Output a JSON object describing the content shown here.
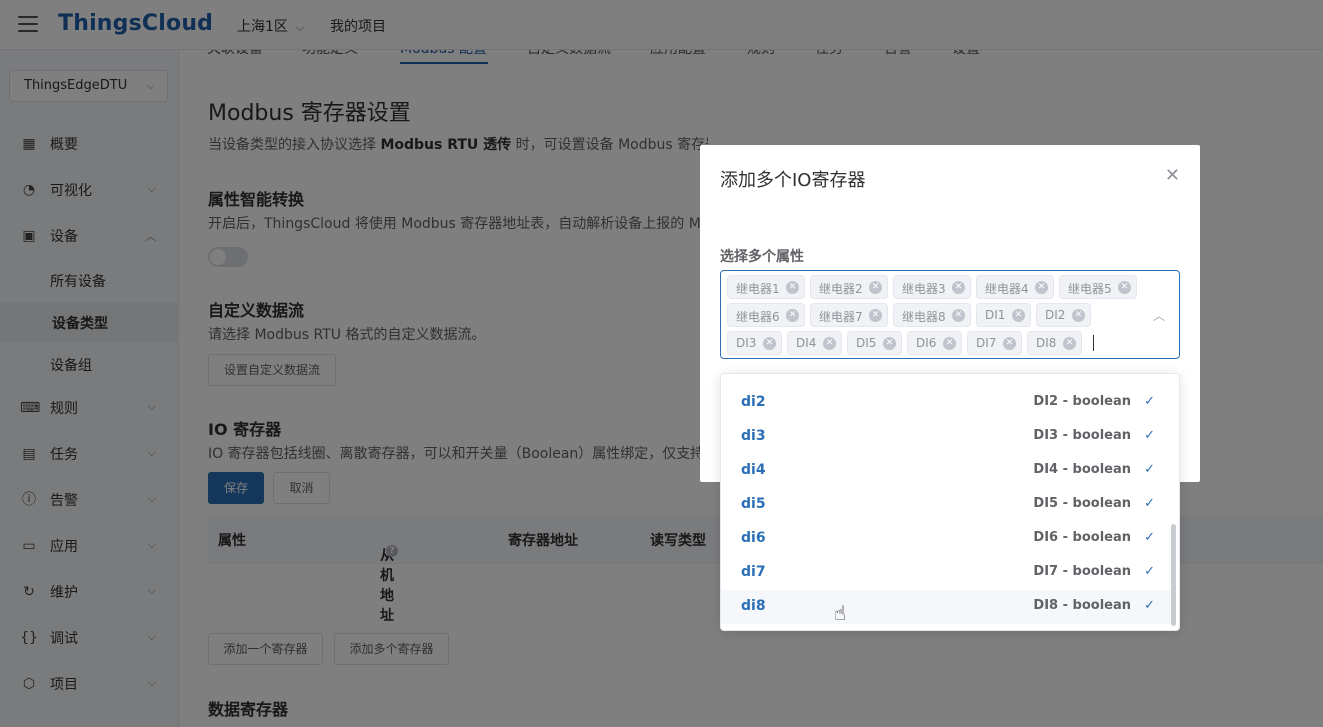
{
  "header": {
    "logo": "ThingsCloud",
    "region": "上海1区",
    "project": "我的项目"
  },
  "sidebar": {
    "device_select": "ThingsEdgeDTU",
    "items": [
      {
        "label": "概要",
        "icon": "dashboard-icon"
      },
      {
        "label": "可视化",
        "icon": "gauge-icon"
      },
      {
        "label": "设备",
        "icon": "device-icon"
      },
      {
        "label": "规则",
        "icon": "terminal-icon"
      },
      {
        "label": "任务",
        "icon": "calendar-icon"
      },
      {
        "label": "告警",
        "icon": "alert-icon"
      },
      {
        "label": "应用",
        "icon": "app-window-icon"
      },
      {
        "label": "维护",
        "icon": "refresh-icon"
      },
      {
        "label": "调试",
        "icon": "braces-icon"
      },
      {
        "label": "项目",
        "icon": "cube-icon"
      }
    ],
    "sub_items": [
      {
        "label": "所有设备"
      },
      {
        "label": "设备类型"
      },
      {
        "label": "设备组"
      }
    ]
  },
  "main": {
    "tabs": [
      "关联设备",
      "功能定义",
      "Modbus 配置",
      "自定义数据流",
      "应用配置",
      "规则",
      "任务",
      "告警",
      "设置"
    ],
    "title": "Modbus 寄存器设置",
    "desc_prefix": "当设备类型的接入协议选择 ",
    "desc_bold": "Modbus RTU 透传",
    "desc_suffix": " 时，可设置设备 Modbus 寄存器地址，用于设备属性和 Modbus 消息之间的自动转换。",
    "smart": {
      "title": "属性智能转换",
      "desc": "开启后，ThingsCloud 将使用 Modbus 寄存器地址表，自动解析设备上报的 M"
    },
    "custom_stream": {
      "title": "自定义数据流",
      "desc": "请选择 Modbus RTU 格式的自定义数据流。",
      "button": "设置自定义数据流"
    },
    "io": {
      "title": "IO 寄存器",
      "desc": "IO 寄存器包括线圈、离散寄存器，可以和开关量（Boolean）属性绑定，仅支持",
      "save": "保存",
      "cancel": "取消",
      "columns": [
        "属性",
        "从机地址",
        "寄存器地址",
        "读写类型"
      ],
      "add_one": "添加一个寄存器",
      "add_many": "添加多个寄存器"
    },
    "data_reg_title": "数据寄存器"
  },
  "dialog": {
    "title": "添加多个IO寄存器",
    "field_label": "选择多个属性",
    "tags": [
      "继电器1",
      "继电器2",
      "继电器3",
      "继电器4",
      "继电器5",
      "继电器6",
      "继电器7",
      "继电器8",
      "DI1",
      "DI2",
      "DI3",
      "DI4",
      "DI5",
      "DI6",
      "DI7",
      "DI8"
    ],
    "options": [
      {
        "key": "di2",
        "value": "DI2 - boolean"
      },
      {
        "key": "di3",
        "value": "DI3 - boolean"
      },
      {
        "key": "di4",
        "value": "DI4 - boolean"
      },
      {
        "key": "di5",
        "value": "DI5 - boolean"
      },
      {
        "key": "di6",
        "value": "DI6 - boolean"
      },
      {
        "key": "di7",
        "value": "DI7 - boolean"
      },
      {
        "key": "di8",
        "value": "DI8 - boolean"
      }
    ]
  },
  "colors": {
    "brand": "#1f5fa8",
    "primary": "#2b6fb6"
  }
}
